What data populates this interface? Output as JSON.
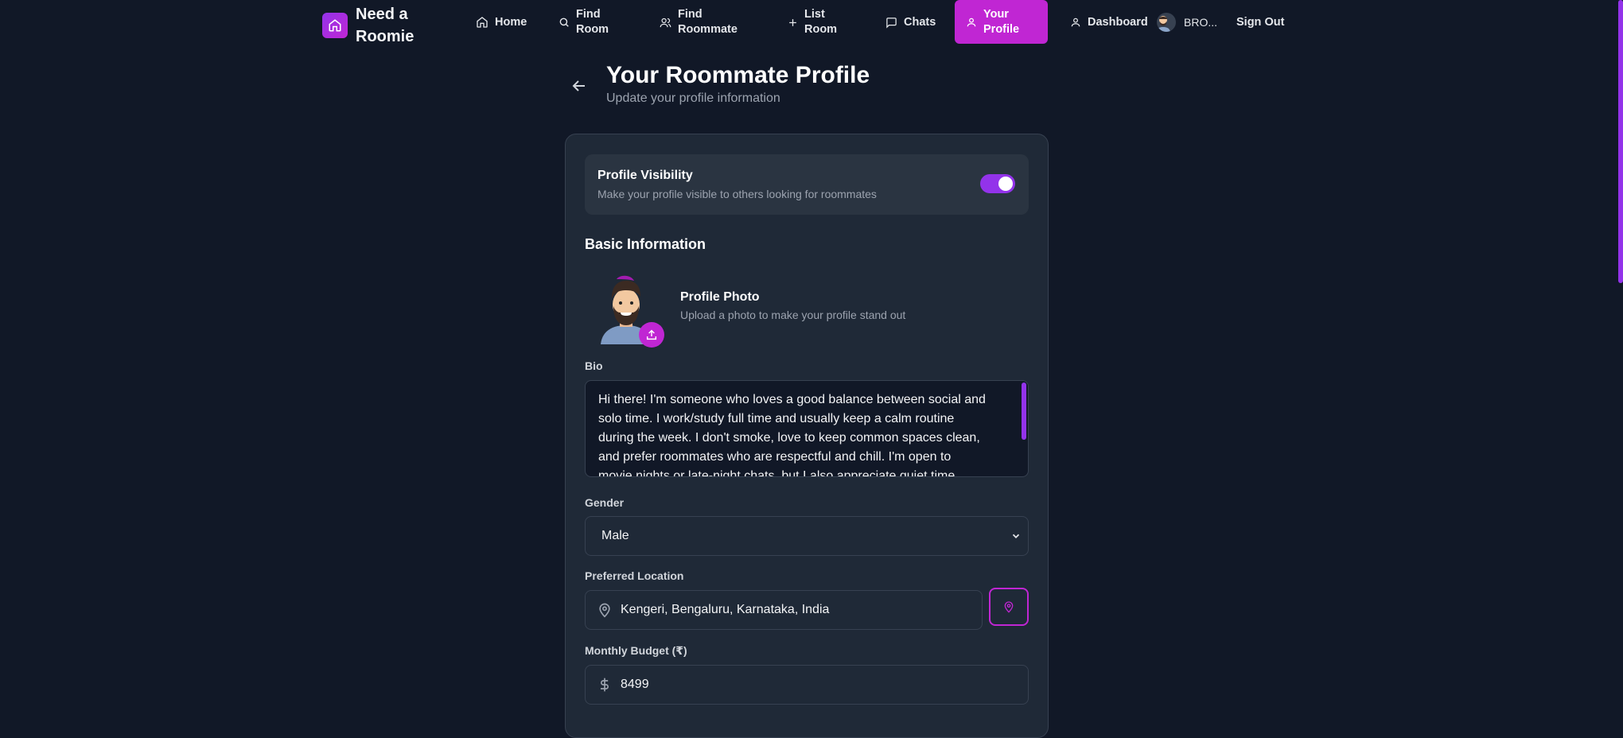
{
  "brand": {
    "name": "Need a Roomie"
  },
  "nav": {
    "home": "Home",
    "find_room": "Find Room",
    "find_roommate": "Find Roommate",
    "list_room": "List Room",
    "chats": "Chats",
    "your_profile": "Your Profile",
    "dashboard": "Dashboard",
    "user_name": "BRO...",
    "sign_out": "Sign Out"
  },
  "header": {
    "title": "Your Roommate Profile",
    "subtitle": "Update your profile information"
  },
  "visibility": {
    "title": "Profile Visibility",
    "subtitle": "Make your profile visible to others looking for roommates",
    "enabled": true
  },
  "basic_info": {
    "title": "Basic Information",
    "photo_title": "Profile Photo",
    "photo_subtitle": "Upload a photo to make your profile stand out"
  },
  "bio": {
    "label": "Bio",
    "value": "Hi there! I'm someone who loves a good balance between social and solo time. I work/study full time and usually keep a calm routine during the week. I don't smoke, love to keep common spaces clean, and prefer roommates who are respectful and chill. I'm open to movie nights or late-night chats, but I also appreciate quiet time. Looking for a room near"
  },
  "gender": {
    "label": "Gender",
    "value": "Male"
  },
  "location": {
    "label": "Preferred Location",
    "value": "Kengeri, Bengaluru, Karnataka, India"
  },
  "budget": {
    "label": "Monthly Budget (₹)",
    "value": "8499"
  },
  "colors": {
    "accent": "#c026d3",
    "accent_alt": "#9333ea",
    "background": "#111827",
    "card": "#1f2937"
  }
}
